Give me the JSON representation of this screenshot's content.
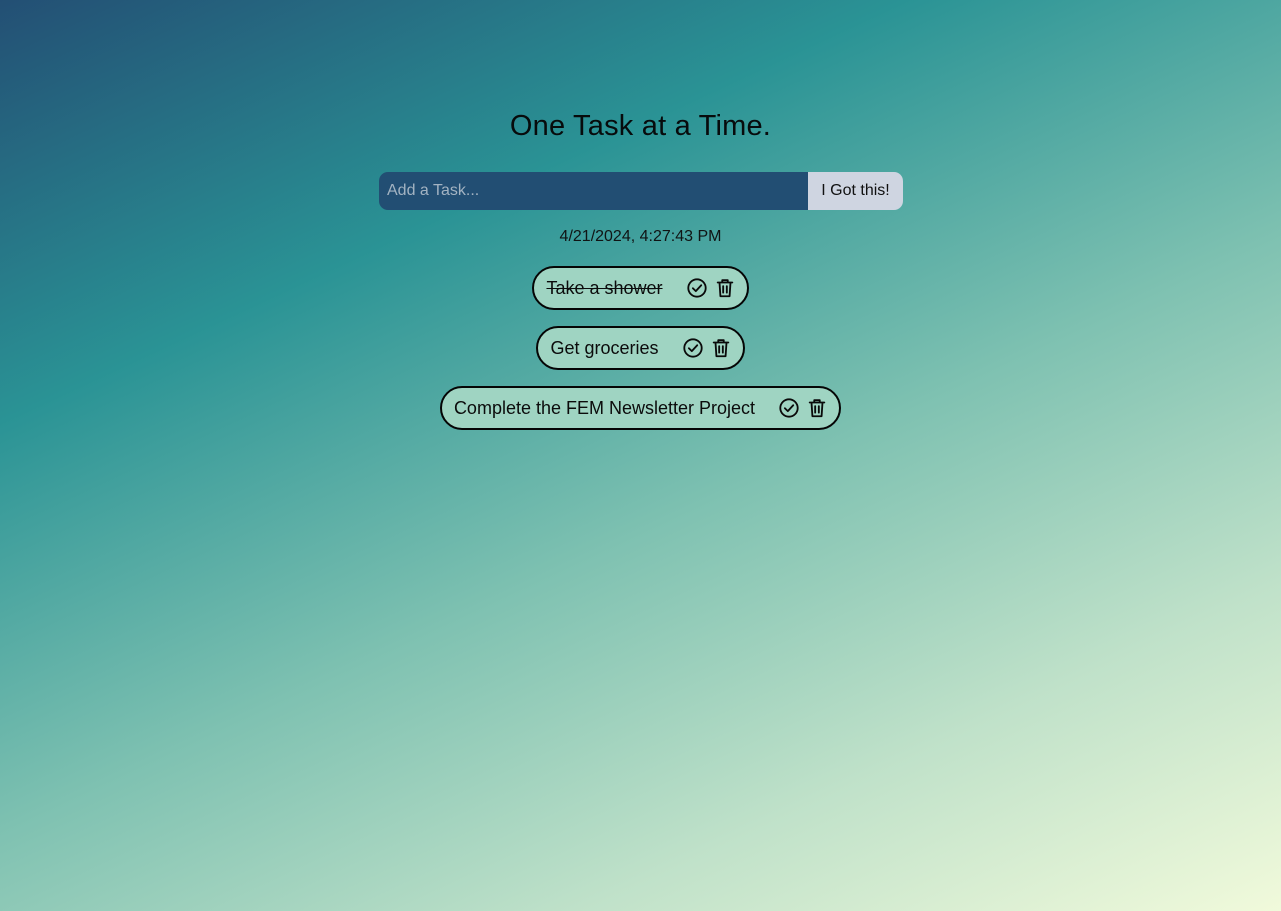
{
  "header": {
    "title": "One Task at a Time."
  },
  "form": {
    "placeholder": "Add a Task...",
    "value": "",
    "submit_label": "I Got this!"
  },
  "timestamp": "4/21/2024, 4:27:43 PM",
  "tasks": [
    {
      "label": "Take a shower",
      "completed": true
    },
    {
      "label": "Get groceries",
      "completed": false
    },
    {
      "label": "Complete the FEM Newsletter Project",
      "completed": false
    }
  ],
  "icons": {
    "complete": "check-circle-icon",
    "delete": "trash-icon"
  },
  "colors": {
    "input_background": "#224e73",
    "button_background": "#cfd5e1",
    "task_background": "#9fd4c2",
    "task_border": "#050505"
  }
}
